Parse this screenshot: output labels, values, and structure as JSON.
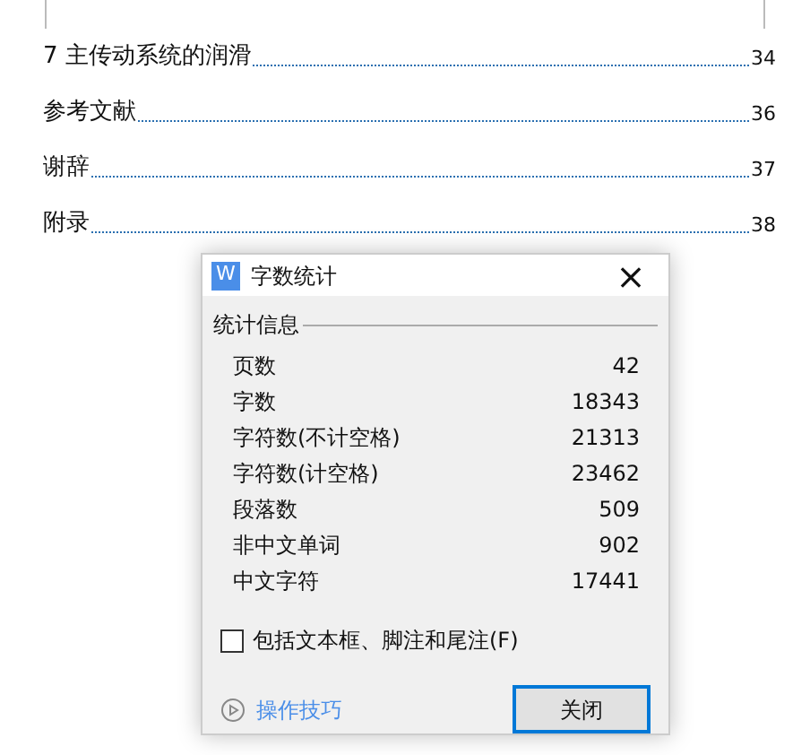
{
  "toc": [
    {
      "title": "7  主传动系统的润滑",
      "page": "34"
    },
    {
      "title": "参考文献",
      "page": "36"
    },
    {
      "title": "谢辞",
      "page": "37"
    },
    {
      "title": "附录",
      "page": "38"
    }
  ],
  "dialog": {
    "app_icon": "W",
    "title": "字数统计",
    "close": "×",
    "group_label": "统计信息",
    "stats": [
      {
        "label": "页数",
        "value": "42"
      },
      {
        "label": "字数",
        "value": "18343"
      },
      {
        "label": "字符数(不计空格)",
        "value": "21313"
      },
      {
        "label": "字符数(计空格)",
        "value": "23462"
      },
      {
        "label": "段落数",
        "value": "509"
      },
      {
        "label": "非中文单词",
        "value": "902"
      },
      {
        "label": "中文字符",
        "value": "17441"
      }
    ],
    "checkbox": {
      "label": "包括文本框、脚注和尾注(F)",
      "checked": false
    },
    "tips_link": "操作技巧",
    "close_button": "关闭"
  }
}
